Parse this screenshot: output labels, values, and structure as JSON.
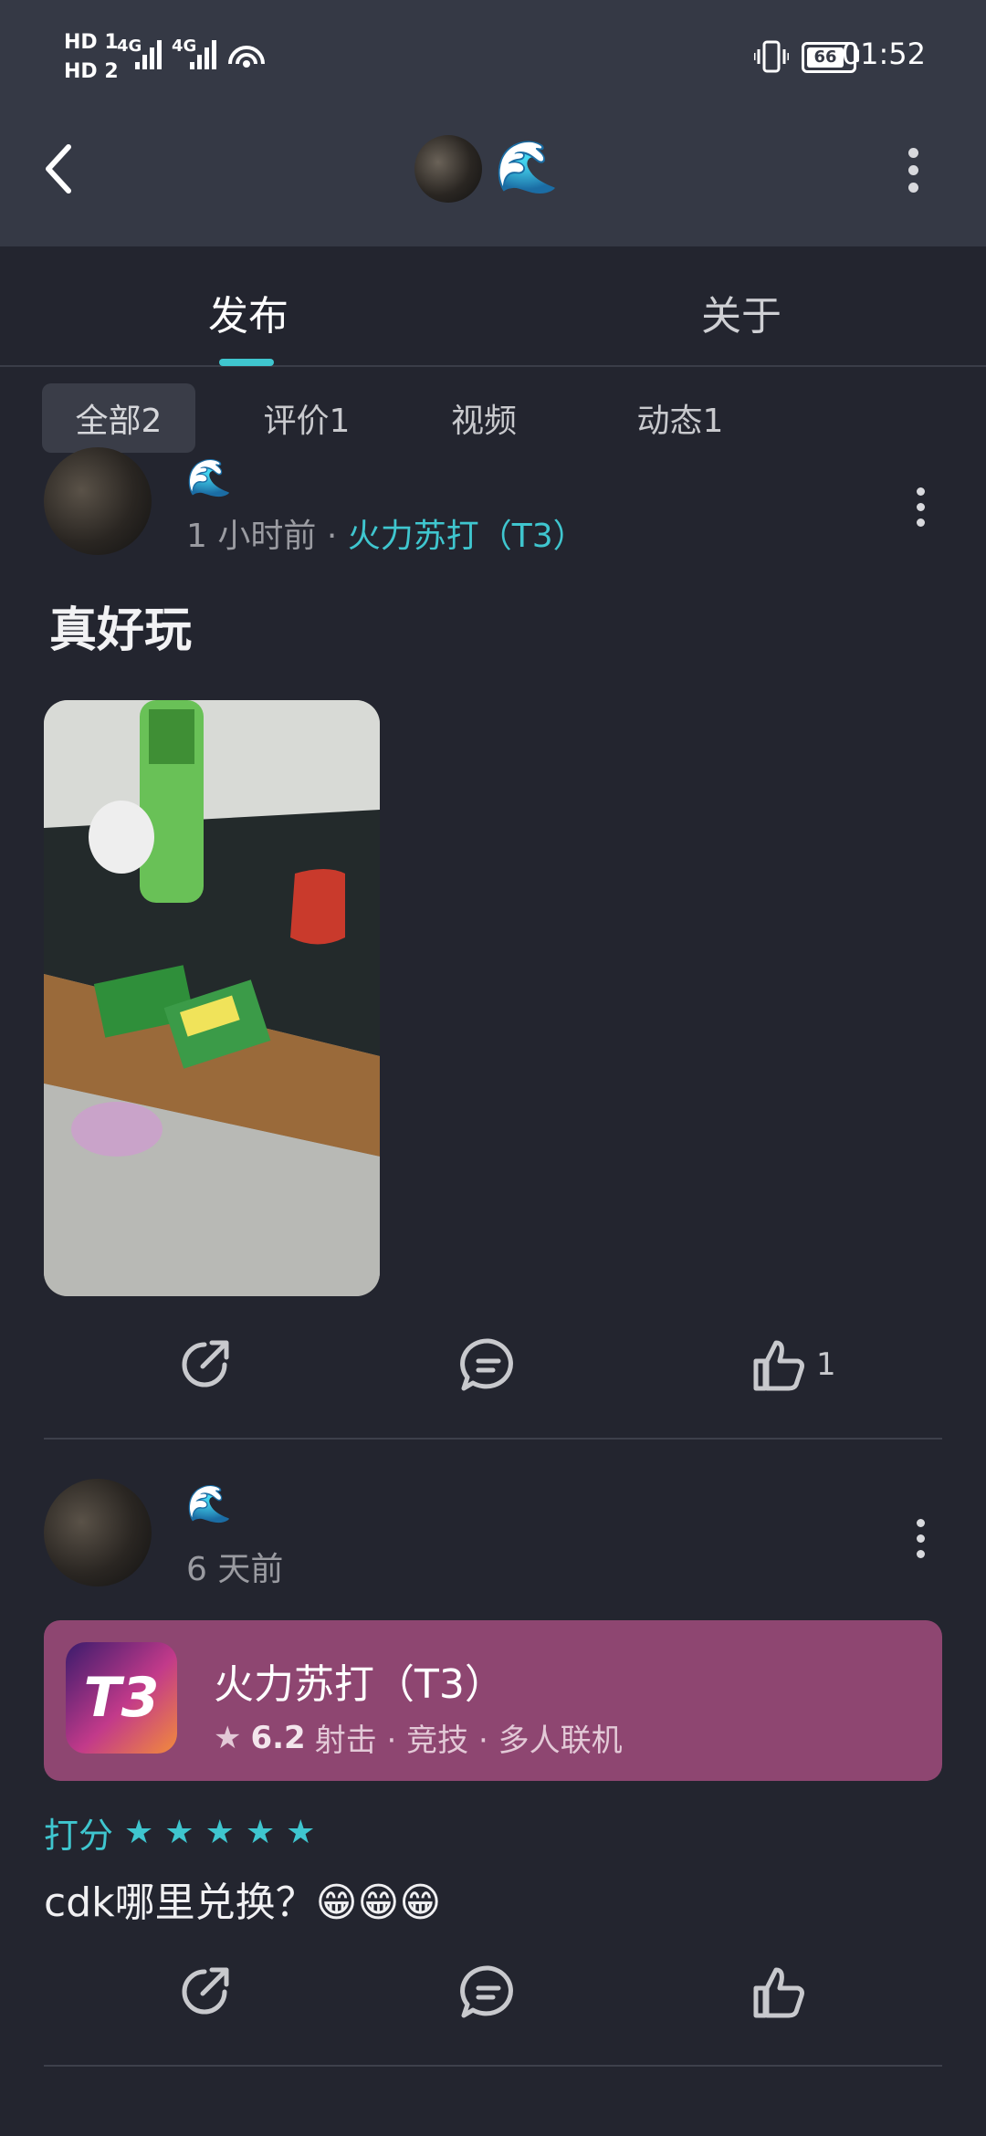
{
  "status_bar": {
    "hd1": "HD 1",
    "hd2": "HD 2",
    "net1": "4G",
    "net2": "4G",
    "battery": "66",
    "time": "01:52"
  },
  "header": {
    "title_emoji": "🌊"
  },
  "tabs": [
    {
      "label": "发布",
      "active": true
    },
    {
      "label": "关于",
      "active": false
    }
  ],
  "filters": [
    {
      "label": "全部2",
      "active": true
    },
    {
      "label": "评价1",
      "active": false
    },
    {
      "label": "视频",
      "active": false
    },
    {
      "label": "动态1",
      "active": false
    }
  ],
  "posts": [
    {
      "username": "🌊",
      "time": "1 小时前",
      "separator": "·",
      "game": "火力苏打（T3）",
      "text": "真好玩",
      "likes": "1"
    },
    {
      "username": "🌊",
      "time": "6 天前",
      "game_card": {
        "icon_text": "T3",
        "title": "火力苏打（T3）",
        "score": "6.2",
        "tags": "射击 · 竞技 · 多人联机"
      },
      "rating_label": "打分",
      "rating_stars": 5,
      "comment": "cdk哪里兑换？😁😁😁"
    }
  ],
  "colors": {
    "accent": "#3fc6cf",
    "card": "#8e4671",
    "background": "#23252f",
    "header": "#353945"
  }
}
